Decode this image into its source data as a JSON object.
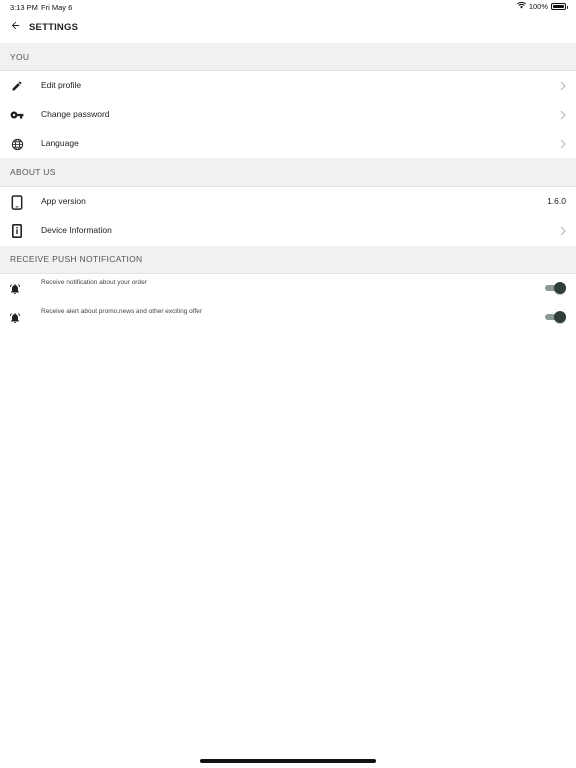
{
  "status_bar": {
    "time": "3:13 PM",
    "date": "Fri May 6",
    "battery": "100%",
    "battery_level": 1.0
  },
  "header": {
    "title": "SETTINGS",
    "back_icon": "arrow-left-icon"
  },
  "sections": {
    "you": {
      "title": "YOU",
      "items": [
        {
          "label": "Edit profile",
          "icon": "pencil-icon"
        },
        {
          "label": "Change password",
          "icon": "key-icon"
        },
        {
          "label": "Language",
          "icon": "globe-icon"
        }
      ]
    },
    "about": {
      "title": "ABOUT US",
      "items": [
        {
          "label": "App version",
          "value": "1.6.0",
          "icon": "tablet-icon"
        },
        {
          "label": "Device Information",
          "icon": "device-info-icon"
        }
      ]
    },
    "push": {
      "title": "RECEIVE PUSH NOTIFICATION",
      "items": [
        {
          "label": "Receive notification about your order",
          "icon": "bell-ringing-icon",
          "enabled": true
        },
        {
          "label": "Receive alert about promo,news and other exciting offer",
          "icon": "bell-ringing-icon",
          "enabled": true
        }
      ]
    }
  },
  "colors": {
    "section_bg": "#f1f1f2",
    "toggle_track": "#8e9a95",
    "toggle_knob": "#2f3e3a"
  }
}
